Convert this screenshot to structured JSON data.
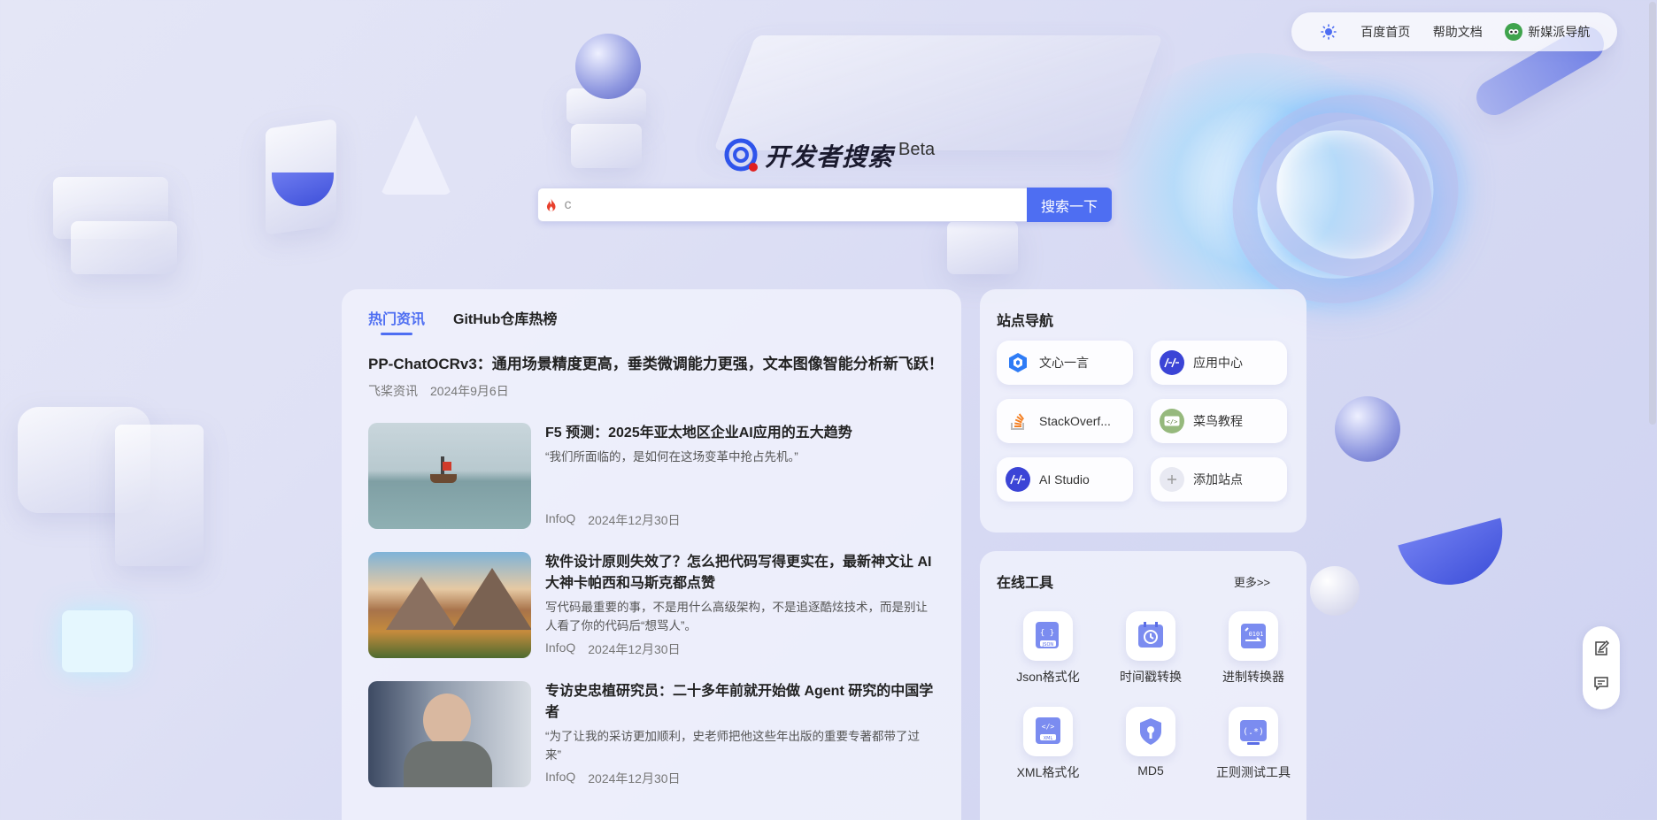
{
  "topnav": {
    "theme_icon": "sun-icon",
    "links": [
      "百度首页",
      "帮助文档",
      "新媒派导航"
    ]
  },
  "brand": {
    "title": "开发者搜索",
    "beta": "Beta"
  },
  "search": {
    "value": "c",
    "button": "搜索一下",
    "icon": "fire-icon"
  },
  "news": {
    "tabs": [
      "热门资讯",
      "GitHub仓库热榜"
    ],
    "headline": {
      "title": "PP-ChatOCRv3：通用场景精度更高，垂类微调能力更强，文本图像智能分析新飞跃！",
      "source": "飞桨资讯",
      "date": "2024年9月6日"
    },
    "items": [
      {
        "title": "F5 预测：2025年亚太地区企业AI应用的五大趋势",
        "desc": "“我们所面临的，是如何在这场变革中抢占先机。”",
        "source": "InfoQ",
        "date": "2024年12月30日"
      },
      {
        "title": "软件设计原则失效了？怎么把代码写得更实在，最新神文让 AI 大神卡帕西和马斯克都点赞",
        "desc": "写代码最重要的事，不是用什么高级架构，不是追逐酷炫技术，而是别让人看了你的代码后“想骂人”。",
        "source": "InfoQ",
        "date": "2024年12月30日"
      },
      {
        "title": "专访史忠植研究员：二十多年前就开始做 Agent 研究的中国学者",
        "desc": "“为了让我的采访更加顺利，史老师把他这些年出版的重要专著都带了过来”",
        "source": "InfoQ",
        "date": "2024年12月30日"
      }
    ]
  },
  "site_nav": {
    "title": "站点导航",
    "sites": [
      {
        "label": "文心一言",
        "icon": "wenxin-icon"
      },
      {
        "label": "应用中心",
        "icon": "app-center-icon"
      },
      {
        "label": "StackOverf...",
        "icon": "stackoverflow-icon"
      },
      {
        "label": "菜鸟教程",
        "icon": "runoob-icon"
      },
      {
        "label": "AI Studio",
        "icon": "ai-studio-icon"
      },
      {
        "label": "添加站点",
        "icon": "plus-icon"
      }
    ]
  },
  "tools": {
    "title": "在线工具",
    "more": "更多>>",
    "items": [
      {
        "label": "Json格式化",
        "icon": "json-icon"
      },
      {
        "label": "时间戳转换",
        "icon": "timestamp-icon"
      },
      {
        "label": "进制转换器",
        "icon": "radix-icon"
      },
      {
        "label": "XML格式化",
        "icon": "xml-icon"
      },
      {
        "label": "MD5",
        "icon": "md5-icon"
      },
      {
        "label": "正则测试工具",
        "icon": "regex-icon"
      }
    ]
  },
  "float": {
    "icons": [
      "edit-icon",
      "feedback-icon"
    ]
  },
  "colors": {
    "accent": "#4e6ef2",
    "brand_red": "#e02020"
  }
}
